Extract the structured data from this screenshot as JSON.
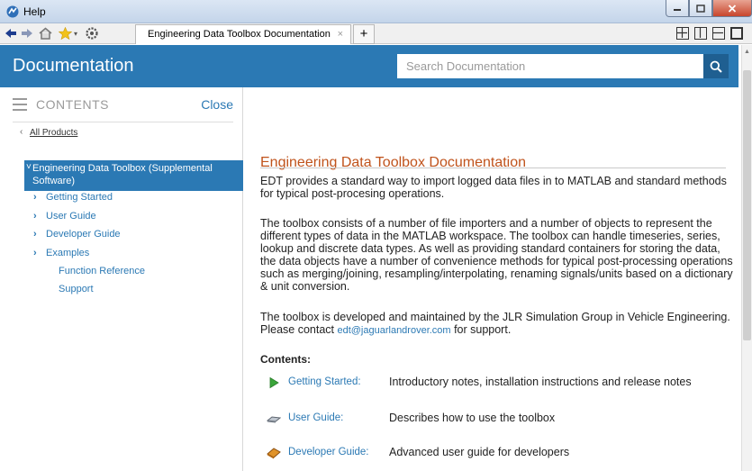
{
  "window": {
    "title": "Help"
  },
  "browser": {
    "tab_label": "Engineering Data Toolbox Documentation",
    "tab_close": "×",
    "new_tab": "+"
  },
  "header": {
    "title": "Documentation",
    "search_placeholder": "Search Documentation"
  },
  "sidebar": {
    "contents_label": "CONTENTS",
    "close_label": "Close",
    "all_products": "All Products",
    "active_item": "Engineering Data Toolbox (Supplemental Software)",
    "items": [
      {
        "label": "Getting Started"
      },
      {
        "label": "User Guide"
      },
      {
        "label": "Developer Guide"
      },
      {
        "label": "Examples"
      }
    ],
    "plain_items": [
      {
        "label": "Function Reference"
      },
      {
        "label": "Support"
      }
    ]
  },
  "main": {
    "title": "Engineering Data Toolbox Documentation",
    "para1": "EDT provides a standard way to import logged data files in to MATLAB and standard methods for typical post-procesing operations.",
    "para2": "The toolbox consists of a number of file importers and a number of objects to represent the different types of data in the MATLAB workspace. The toolbox can handle timeseries, series, lookup and discrete data types. As well as providing standard containers for storing the data, the data objects have a number of convenience methods for typical post-processing operations such as merging/joining, resampling/interpolating, renaming signals/units based on a dictionary & unit conversion.",
    "para3_before": "The toolbox is developed and maintained by the JLR Simulation Group in Vehicle Engineering. Please contact ",
    "para3_email": "edt@jaguarlandrover.com",
    "para3_after": " for support.",
    "contents_heading": "Contents:",
    "contents": [
      {
        "link": "Getting Started:",
        "desc": "Introductory notes, installation instructions and release notes",
        "icon": "play-icon"
      },
      {
        "link": "User Guide:",
        "desc": "Describes how to use the toolbox",
        "icon": "user-guide-icon"
      },
      {
        "link": "Developer Guide:",
        "desc": "Advanced user guide for developers",
        "icon": "developer-guide-icon"
      }
    ]
  },
  "colors": {
    "header_blue": "#2b79b4",
    "title_orange": "#c0531c",
    "link_blue": "#2b79b4"
  }
}
